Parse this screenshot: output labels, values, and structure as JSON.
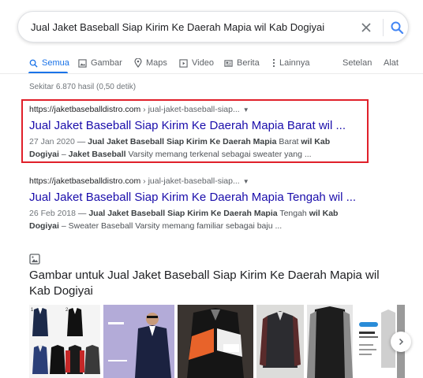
{
  "search": {
    "query": "Jual Jaket Baseball Siap Kirim Ke Daerah Mapia wil Kab Dogiyai"
  },
  "tabs": [
    {
      "label": "Semua",
      "icon": "search-icon",
      "active": true
    },
    {
      "label": "Gambar",
      "icon": "image-icon"
    },
    {
      "label": "Maps",
      "icon": "map-pin-icon"
    },
    {
      "label": "Video",
      "icon": "video-icon"
    },
    {
      "label": "Berita",
      "icon": "news-icon"
    },
    {
      "label": "Lainnya",
      "icon": "more-icon"
    }
  ],
  "tools": {
    "settings": "Setelan",
    "tools": "Alat"
  },
  "stats": "Sekitar 6.870 hasil (0,50 detik)",
  "results": [
    {
      "domain": "https://jaketbaseballdistro.com",
      "path": " › jual-jaket-baseball-siap...",
      "title": "Jual Jaket Baseball Siap Kirim Ke Daerah Mapia Barat wil ...",
      "date": "27 Jan 2020",
      "snippet_parts": [
        {
          "t": " — "
        },
        {
          "t": "Jual Jaket Baseball Siap Kirim Ke Daerah Mapia",
          "b": true
        },
        {
          "t": " Barat "
        },
        {
          "t": "wil Kab Dogiyai",
          "b": true
        },
        {
          "t": " – "
        },
        {
          "t": "Jaket Baseball",
          "b": true
        },
        {
          "t": " Varsity memang terkenal sebagai sweater yang ..."
        }
      ]
    },
    {
      "domain": "https://jaketbaseballdistro.com",
      "path": " › jual-jaket-baseball-siap...",
      "title": "Jual Jaket Baseball Siap Kirim Ke Daerah Mapia Tengah wil ...",
      "date": "26 Feb 2018",
      "snippet_parts": [
        {
          "t": " — "
        },
        {
          "t": "Jual Jaket Baseball Siap Kirim Ke Daerah Mapia",
          "b": true
        },
        {
          "t": " Tengah "
        },
        {
          "t": "wil Kab Dogiyai",
          "b": true
        },
        {
          "t": " – Sweater Baseball Varsity memang familiar sebagai baju ..."
        }
      ]
    }
  ],
  "images_section": {
    "heading": "Gambar untuk Jual Jaket Baseball Siap Kirim Ke Daerah Mapia wil Kab Dogiyai"
  },
  "colors": {
    "link": "#1a0dab",
    "accent": "#1a73e8",
    "highlight_border": "#e0202a"
  }
}
